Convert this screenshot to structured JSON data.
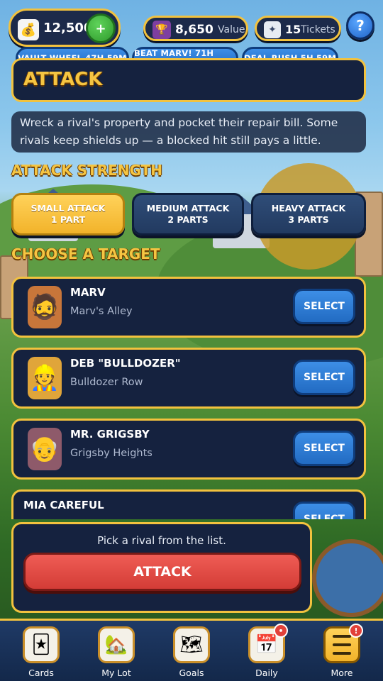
{
  "currency": {
    "coins": "12,500",
    "coins_add_label": "+",
    "value_amount": "8,650",
    "value_label": "Value",
    "tickets_amount": "15",
    "tickets_label": "Tickets",
    "help_label": "?"
  },
  "events": [
    {
      "label": "VAULT WHEEL 47H 59M"
    },
    {
      "label": "BEAT MARV! 71H 59M"
    },
    {
      "label": "DEAL RUSH 5H 59M"
    }
  ],
  "attack": {
    "title": "ATTACK",
    "description": "Wreck a rival's property and pocket their repair bill. Some rivals keep shields up — a blocked hit still pays a little.",
    "strength_title": "ATTACK STRENGTH",
    "strength_options": [
      {
        "line1": "SMALL ATTACK",
        "line2": "1 PART",
        "selected": true
      },
      {
        "line1": "MEDIUM ATTACK",
        "line2": "2 PARTS",
        "selected": false
      },
      {
        "line1": "HEAVY ATTACK",
        "line2": "3 PARTS",
        "selected": false
      }
    ],
    "target_title": "CHOOSE A TARGET"
  },
  "targets": [
    {
      "name": "MARV",
      "location": "Marv's Alley",
      "select_label": "SELECT",
      "icon": "person-icon"
    },
    {
      "name": "DEB \"BULLDOZER\"",
      "location": "Bulldozer Row",
      "select_label": "SELECT",
      "icon": "person-icon"
    },
    {
      "name": "MR. GRIGSBY",
      "location": "Grigsby Heights",
      "select_label": "SELECT",
      "icon": "person-icon"
    },
    {
      "name": "MIA CAREFUL",
      "location": "",
      "select_label": "SELECT",
      "icon": "person-icon"
    }
  ],
  "action": {
    "hint": "Pick a rival from the list.",
    "button_label": "ATTACK"
  },
  "nav": [
    {
      "label": "Cards",
      "icon": "cards-icon"
    },
    {
      "label": "My Lot",
      "icon": "lot-icon"
    },
    {
      "label": "Goals",
      "icon": "map-icon"
    },
    {
      "label": "Daily",
      "icon": "calendar-icon",
      "badge": "•"
    },
    {
      "label": "More",
      "icon": "menu-icon",
      "badge": "!"
    }
  ],
  "colors": {
    "accent_gold": "#f2c23e",
    "panel_navy": "#15223f",
    "button_blue": "#226bc2",
    "attack_red": "#d33c36"
  }
}
